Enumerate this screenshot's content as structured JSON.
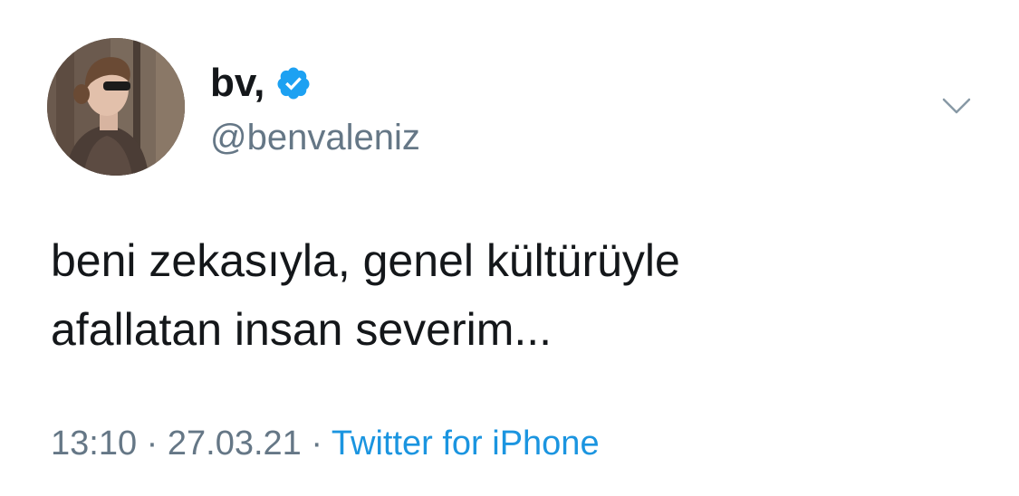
{
  "tweet": {
    "display_name": "bv,",
    "verified": true,
    "handle": "@benvaleniz",
    "text_lines": [
      "beni zekasıyla, genel kültürüyle",
      "afallatan insan severim..."
    ],
    "time": "13:10",
    "separator": "·",
    "date": "27.03.21",
    "source": "Twitter for iPhone"
  },
  "icons": {
    "verified": "verified-badge-icon",
    "more": "chevron-down-icon"
  },
  "colors": {
    "text_primary": "#14171a",
    "text_secondary": "#657786",
    "link": "#1b95e0",
    "verified": "#1da1f2"
  }
}
